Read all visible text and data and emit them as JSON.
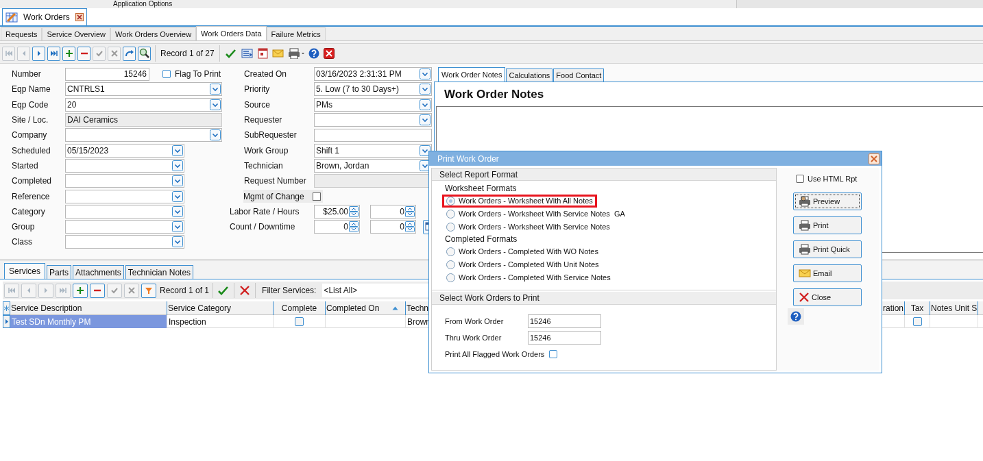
{
  "top_strip": {
    "title": "Application Options"
  },
  "document_tab": {
    "title": "Work Orders"
  },
  "tabs": [
    {
      "label": "Requests",
      "selected": false
    },
    {
      "label": "Service Overview",
      "selected": false
    },
    {
      "label": "Work Orders Overview",
      "selected": false
    },
    {
      "label": "Work Orders Data",
      "selected": true
    },
    {
      "label": "Failure Metrics",
      "selected": false
    }
  ],
  "toolbar": {
    "buttons": [
      {
        "kind": "first",
        "disabled": true
      },
      {
        "kind": "prev",
        "disabled": true
      },
      {
        "kind": "next",
        "disabled": false
      },
      {
        "kind": "last",
        "disabled": false
      },
      {
        "kind": "add",
        "disabled": false
      },
      {
        "kind": "delete",
        "disabled": false
      },
      {
        "kind": "post",
        "disabled": true
      },
      {
        "kind": "cancel",
        "disabled": true
      },
      {
        "kind": "refresh",
        "disabled": false
      },
      {
        "kind": "search",
        "disabled": false
      }
    ],
    "record": "Record 1 of 27"
  },
  "form": {
    "left": [
      {
        "label": "Number",
        "kind": "number",
        "value": "15246"
      },
      {
        "label": "Eqp Name",
        "kind": "dropdown",
        "value": "CNTRLS1"
      },
      {
        "label": "Eqp Code",
        "kind": "dropdown",
        "value": "20"
      },
      {
        "label": "Site / Loc.",
        "kind": "readonly",
        "value": "DAI Ceramics"
      },
      {
        "label": "Company",
        "kind": "dropdown"
      },
      {
        "label": "Scheduled",
        "kind": "dropdown",
        "value": "05/15/2023"
      },
      {
        "label": "Started",
        "kind": "dropdown"
      },
      {
        "label": "Completed",
        "kind": "dropdown"
      },
      {
        "label": "Reference",
        "kind": "dropdown"
      },
      {
        "label": "Category",
        "kind": "dropdown"
      },
      {
        "label": "Group",
        "kind": "dropdown"
      },
      {
        "label": "Class",
        "kind": "dropdown"
      }
    ],
    "flag_to_print": {
      "label": "Flag To Print",
      "checked": false
    },
    "right": [
      {
        "label": "Created On",
        "kind": "dropdown",
        "value": "03/16/2023 2:31:31 PM"
      },
      {
        "label": "Priority",
        "kind": "dropdown",
        "value": "5. Low (7 to 30 Days+)"
      },
      {
        "label": "Source",
        "kind": "dropdown",
        "value": "PMs"
      },
      {
        "label": "Requester",
        "kind": "dropdown"
      },
      {
        "label": "SubRequester",
        "kind": "text"
      },
      {
        "label": "Work Group",
        "kind": "dropdown",
        "value": "Shift 1"
      },
      {
        "label": "Technician",
        "kind": "dropdown",
        "value": "Brown, Jordan"
      },
      {
        "label": "Request Number",
        "kind": "readonly"
      },
      {
        "label": "Mgmt of Change",
        "kind": "checkbox",
        "checked": false
      },
      {
        "label": "Labor Rate / Hours",
        "kind": "spin",
        "values": [
          "$25.00",
          "0"
        ]
      },
      {
        "label": "Count / Downtime",
        "kind": "spin",
        "values": [
          "0",
          "0"
        ]
      }
    ]
  },
  "notes": {
    "tabs": [
      {
        "label": "Work Order Notes",
        "selected": true
      },
      {
        "label": "Calculations",
        "selected": false
      },
      {
        "label": "Food Contact",
        "selected": false
      }
    ],
    "heading": "Work Order Notes"
  },
  "detail_tabs": [
    {
      "label": "Services",
      "selected": true
    },
    {
      "label": "Parts",
      "selected": false
    },
    {
      "label": "Attachments",
      "selected": false
    },
    {
      "label": "Technician Notes",
      "selected": false
    }
  ],
  "services_toolbar": {
    "buttons": [
      {
        "kind": "first",
        "disabled": true
      },
      {
        "kind": "prev",
        "disabled": true
      },
      {
        "kind": "next",
        "disabled": true
      },
      {
        "kind": "last",
        "disabled": true
      },
      {
        "kind": "add",
        "disabled": false
      },
      {
        "kind": "delete",
        "disabled": false
      },
      {
        "kind": "post",
        "disabled": true
      },
      {
        "kind": "cancel",
        "disabled": true
      },
      {
        "kind": "filter",
        "disabled": false
      }
    ],
    "record": "Record 1 of 1",
    "filter_label": "Filter Services:",
    "filter_value": "<List All>"
  },
  "table": {
    "columns": [
      "Service Description",
      "Service Category",
      "Complete",
      "Completed On",
      "Techn",
      "ration",
      "Tax",
      "Notes Unit S"
    ],
    "rows": [
      {
        "selected": true,
        "cells": [
          "Test SDn Monthly PM",
          "Inspection",
          {
            "checked": false
          },
          "",
          "Brown",
          "",
          {
            "checked": false
          },
          ""
        ]
      }
    ]
  },
  "dialog": {
    "title": "Print Work Order",
    "format_section": "Select Report Format",
    "groups": [
      {
        "title": "Worksheet Formats",
        "options": [
          {
            "label": "Work Orders - Worksheet With All Notes",
            "selected": true,
            "highlighted": true
          },
          {
            "label": "Work Orders - Worksheet With Service Notes  GA",
            "selected": false,
            "highlighted": false
          },
          {
            "label": "Work Orders - Worksheet With Service Notes",
            "selected": false,
            "highlighted": false
          }
        ]
      },
      {
        "title": "Completed Formats",
        "options": [
          {
            "label": "Work Orders - Completed With WO Notes",
            "selected": false,
            "highlighted": false
          },
          {
            "label": "Work Orders - Completed With Unit Notes",
            "selected": false,
            "highlighted": false
          },
          {
            "label": "Work Orders - Completed With Service Notes",
            "selected": false,
            "highlighted": false
          }
        ]
      }
    ],
    "range_section": "Select Work Orders to Print",
    "from": {
      "label": "From Work Order",
      "value": "15246"
    },
    "thru": {
      "label": "Thru Work Order",
      "value": "15246"
    },
    "print_flagged": {
      "label": "Print All Flagged Work Orders",
      "checked": false
    },
    "use_html": {
      "label": "Use HTML Rpt",
      "checked": false
    },
    "buttons": [
      {
        "kind": "preview",
        "label": "Preview",
        "focused": true
      },
      {
        "kind": "print",
        "label": "Print",
        "focused": false
      },
      {
        "kind": "print",
        "label": "Print Quick",
        "focused": false
      },
      {
        "kind": "email",
        "label": "Email",
        "focused": false
      },
      {
        "kind": "close",
        "label": "Close",
        "focused": false
      }
    ]
  }
}
